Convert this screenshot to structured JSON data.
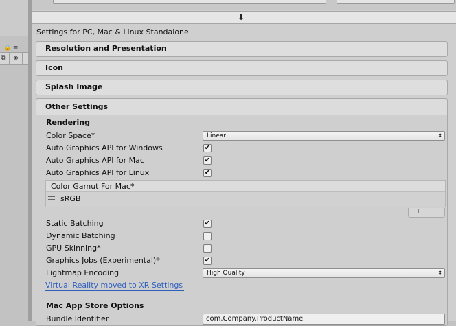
{
  "left": {
    "icons": [
      "lock-icon",
      "menu-icon",
      "scene-icon",
      "tag-icon"
    ]
  },
  "platform": {
    "icon": "download-arrow-icon",
    "glyph": "⬇"
  },
  "settings_title": "Settings for PC, Mac & Linux Standalone",
  "sections": {
    "resolution": "Resolution and Presentation",
    "icon": "Icon",
    "splash": "Splash Image",
    "other": "Other Settings"
  },
  "rendering": {
    "heading": "Rendering",
    "color_space_label": "Color Space*",
    "color_space_value": "Linear",
    "auto_windows_label": "Auto Graphics API for Windows",
    "auto_windows_checked": true,
    "auto_mac_label": "Auto Graphics API for Mac",
    "auto_mac_checked": true,
    "auto_linux_label": "Auto Graphics API for Linux",
    "auto_linux_checked": true,
    "gamut_title": "Color Gamut For Mac*",
    "gamut_item": "sRGB",
    "plus": "+",
    "minus": "−",
    "static_batching_label": "Static Batching",
    "static_batching_checked": true,
    "dynamic_batching_label": "Dynamic Batching",
    "dynamic_batching_checked": false,
    "gpu_skinning_label": "GPU Skinning*",
    "gpu_skinning_checked": false,
    "graphics_jobs_label": "Graphics Jobs (Experimental)*",
    "graphics_jobs_checked": true,
    "lightmap_label": "Lightmap Encoding",
    "lightmap_value": "High Quality",
    "vr_link": "Virtual Reality moved to XR Settings"
  },
  "mac_store": {
    "heading": "Mac App Store Options",
    "bundle_label": "Bundle Identifier",
    "bundle_value": "com.Company.ProductName"
  },
  "glyphs": {
    "check": "✔",
    "dropdown": "⬍",
    "lock": "🔒",
    "menu": "≡",
    "tag": "◈",
    "scene": "⧉"
  }
}
